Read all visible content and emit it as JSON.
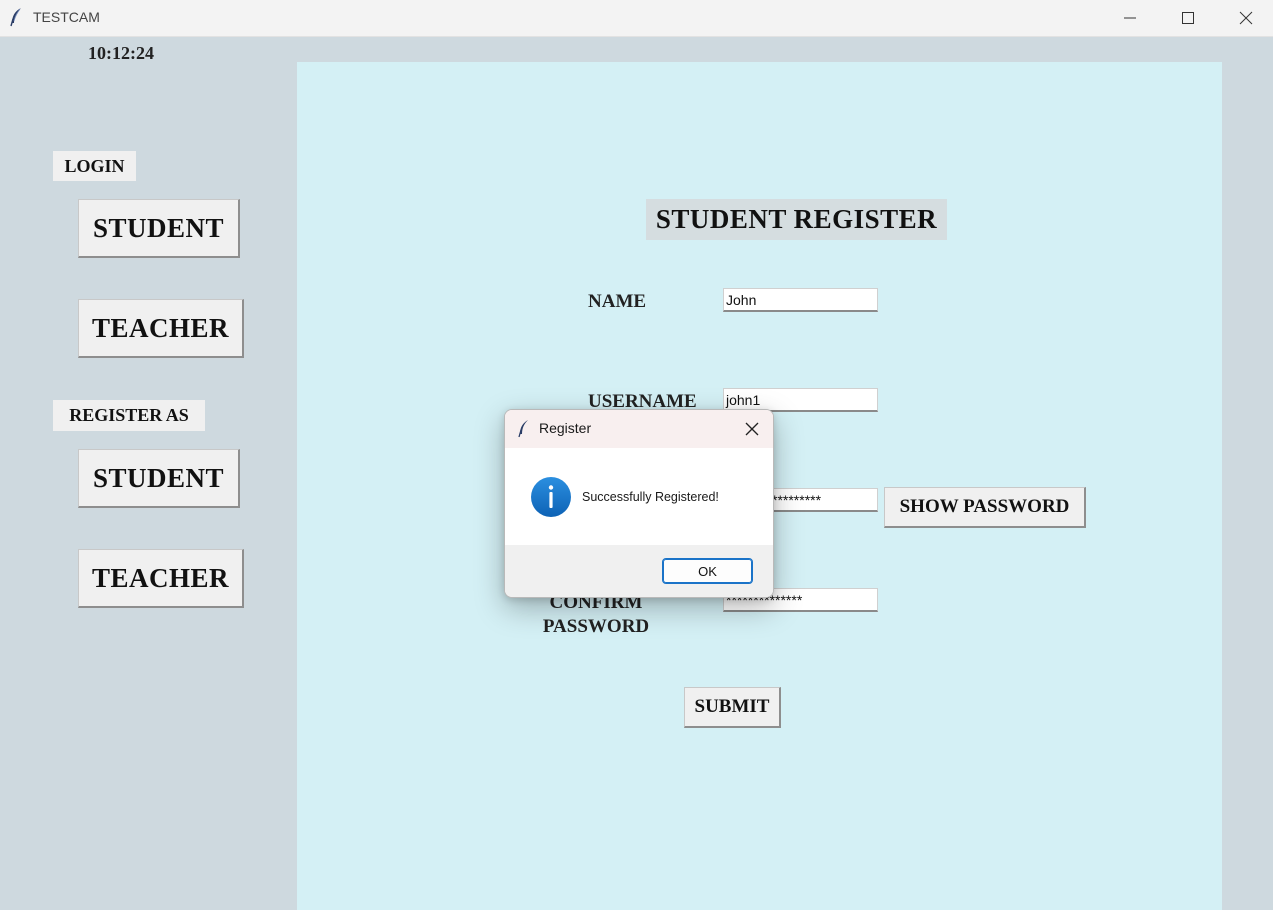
{
  "window": {
    "title": "TESTCAM"
  },
  "clock": "10:12:24",
  "sidebar": {
    "login_label": "LOGIN",
    "login_student": "STUDENT",
    "login_teacher": "TEACHER",
    "register_label": "REGISTER AS",
    "register_student": "STUDENT",
    "register_teacher": "TEACHER"
  },
  "form": {
    "title": "STUDENT REGISTER",
    "name_label": "NAME",
    "name_value": "John",
    "username_label": "USERNAME",
    "username_value": "john1",
    "password_value": "*********",
    "show_password": "SHOW PASSWORD",
    "confirm_label_line1": "CONFIRM",
    "confirm_label_line2": "PASSWORD",
    "confirm_value": "**************",
    "submit": "SUBMIT"
  },
  "dialog": {
    "title": "Register",
    "message": "Successfully Registered!",
    "ok": "OK",
    "icon": "info-icon",
    "accent": "#1a73c8"
  }
}
